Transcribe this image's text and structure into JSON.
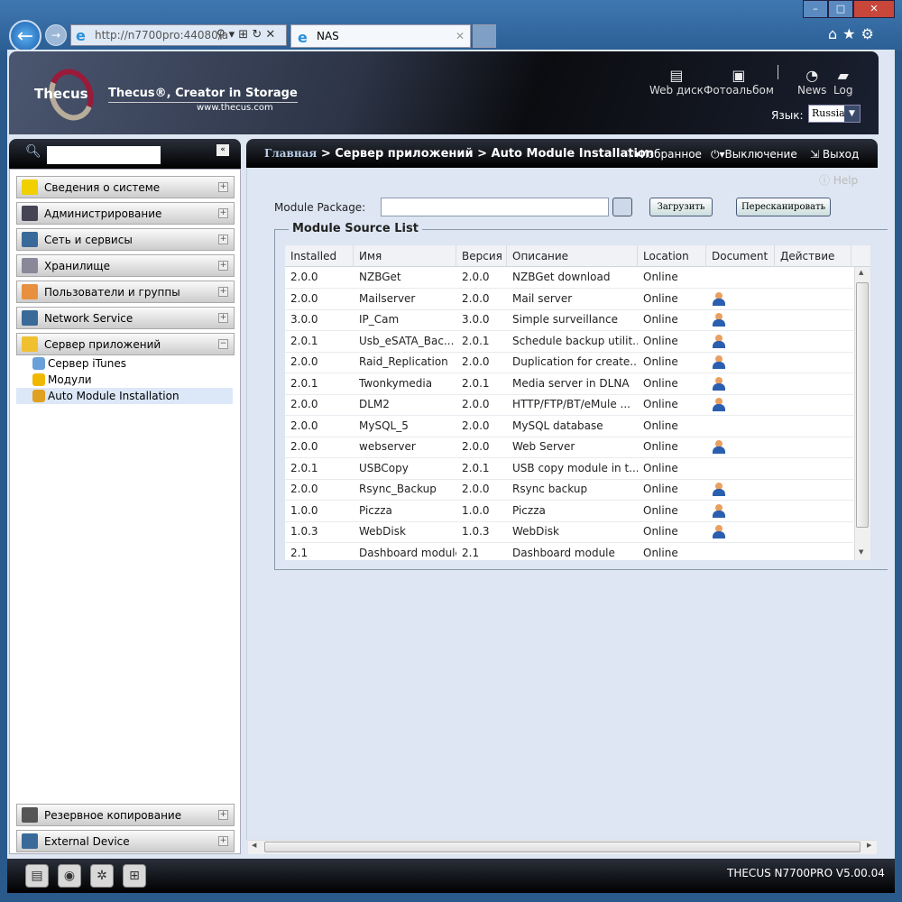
{
  "browser": {
    "address": "http://n7700pro:44080/a",
    "tab_title": "NAS"
  },
  "banner": {
    "brand": "Thecus",
    "slogan": "Thecus®, Creator in Storage",
    "site": "www.thecus.com",
    "links": [
      {
        "label": "Web диск",
        "icon": "hdd-icon"
      },
      {
        "label": "Фотоальбом",
        "icon": "photo-icon"
      },
      {
        "label": "News",
        "icon": "rss-icon"
      },
      {
        "label": "Log",
        "icon": "speech-icon"
      }
    ],
    "lang_label": "Язык:",
    "lang_value": "Russia"
  },
  "sidebar": {
    "search_placeholder": "",
    "sections": [
      {
        "label": "Сведения о системе",
        "color": "#f0d000",
        "state": "+"
      },
      {
        "label": "Администрирование",
        "color": "#445",
        "state": "+"
      },
      {
        "label": "Сеть и сервисы",
        "color": "#3a6a9a",
        "state": "+"
      },
      {
        "label": "Хранилище",
        "color": "#889",
        "state": "+"
      },
      {
        "label": "Пользователи и группы",
        "color": "#e89040",
        "state": "+"
      },
      {
        "label": "Network Service",
        "color": "#3a6a9a",
        "state": "+"
      },
      {
        "label": "Сервер приложений",
        "color": "#f0c030",
        "state": "−"
      }
    ],
    "subitems": [
      {
        "label": "Сервер iTunes",
        "color": "#6aa0d8"
      },
      {
        "label": "Модули",
        "color": "#f0b800"
      },
      {
        "label": "Auto Module Installation",
        "color": "#e0a020"
      }
    ],
    "bottom_sections": [
      {
        "label": "Резервное копирование",
        "state": "+"
      },
      {
        "label": "External Device",
        "state": "+"
      }
    ]
  },
  "header": {
    "crumb_home": "Главная",
    "crumb_rest": " > Сервер приложений > Auto Module Installation",
    "favorites": "Избранное",
    "shutdown": "Выключение",
    "logout": "Выход",
    "help": "Help"
  },
  "form": {
    "package_label": "Module Package:",
    "package_value": "",
    "upload": "Загрузить",
    "rescan": "Пересканировать",
    "legend": "Module Source List"
  },
  "table": {
    "columns": [
      "Installed",
      "Имя",
      "Версия",
      "Описание",
      "Location",
      "Document",
      "Действие"
    ],
    "rows": [
      {
        "installed": "2.0.0",
        "name": "NZBGet",
        "version": "2.0.0",
        "desc": "NZBGet download",
        "location": "Online",
        "doc": false
      },
      {
        "installed": "2.0.0",
        "name": "Mailserver",
        "version": "2.0.0",
        "desc": "Mail server",
        "location": "Online",
        "doc": true
      },
      {
        "installed": "3.0.0",
        "name": "IP_Cam",
        "version": "3.0.0",
        "desc": "Simple surveillance",
        "location": "Online",
        "doc": true
      },
      {
        "installed": "2.0.1",
        "name": "Usb_eSATA_Bac...",
        "version": "2.0.1",
        "desc": "Schedule backup utilit...",
        "location": "Online",
        "doc": true
      },
      {
        "installed": "2.0.0",
        "name": "Raid_Replication",
        "version": "2.0.0",
        "desc": "Duplication for create...",
        "location": "Online",
        "doc": true
      },
      {
        "installed": "2.0.1",
        "name": "Twonkymedia",
        "version": "2.0.1",
        "desc": "Media server in DLNA",
        "location": "Online",
        "doc": true
      },
      {
        "installed": "2.0.0",
        "name": "DLM2",
        "version": "2.0.0",
        "desc": "HTTP/FTP/BT/eMule ...",
        "location": "Online",
        "doc": true
      },
      {
        "installed": "2.0.0",
        "name": "MySQL_5",
        "version": "2.0.0",
        "desc": "MySQL database",
        "location": "Online",
        "doc": false
      },
      {
        "installed": "2.0.0",
        "name": "webserver",
        "version": "2.0.0",
        "desc": "Web Server",
        "location": "Online",
        "doc": true
      },
      {
        "installed": "2.0.1",
        "name": "USBCopy",
        "version": "2.0.1",
        "desc": "USB copy module in t...",
        "location": "Online",
        "doc": false
      },
      {
        "installed": "2.0.0",
        "name": "Rsync_Backup",
        "version": "2.0.0",
        "desc": "Rsync backup",
        "location": "Online",
        "doc": true
      },
      {
        "installed": "1.0.0",
        "name": "Piczza",
        "version": "1.0.0",
        "desc": "Piczza",
        "location": "Online",
        "doc": true
      },
      {
        "installed": "1.0.3",
        "name": "WebDisk",
        "version": "1.0.3",
        "desc": "WebDisk",
        "location": "Online",
        "doc": true
      },
      {
        "installed": "2.1",
        "name": "Dashboard module",
        "version": "2.1",
        "desc": "Dashboard module",
        "location": "Online",
        "doc": false
      }
    ]
  },
  "footer": {
    "version": "THECUS N7700PRO V5.00.04"
  }
}
